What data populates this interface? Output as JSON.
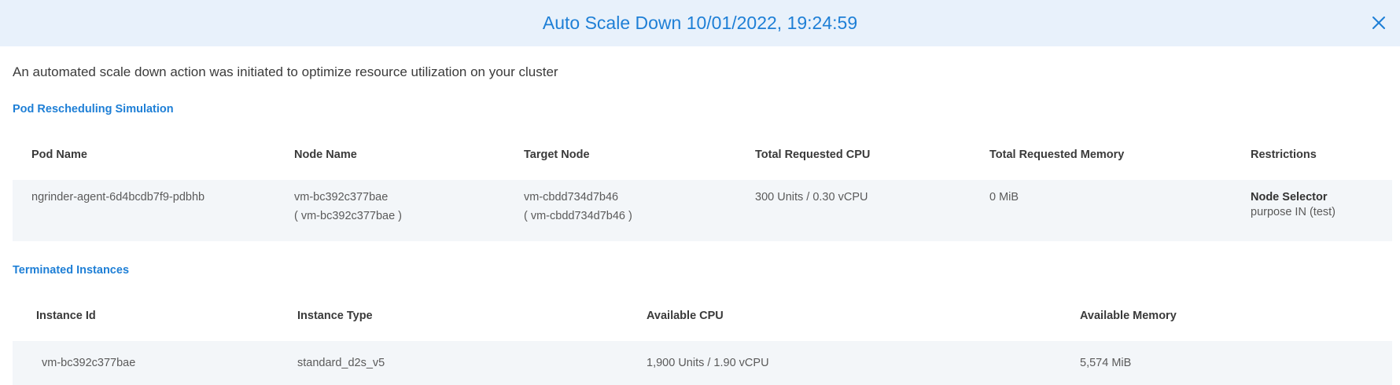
{
  "header": {
    "title": "Auto Scale Down 10/01/2022, 19:24:59",
    "close_icon": "close-icon"
  },
  "description": "An automated scale down action was initiated to optimize resource utilization on your cluster",
  "pod_section": {
    "title": "Pod Rescheduling Simulation",
    "columns": [
      "Pod Name",
      "Node Name",
      "Target Node",
      "Total Requested CPU",
      "Total Requested Memory",
      "Restrictions"
    ],
    "rows": [
      {
        "pod_name": "ngrinder-agent-6d4bcdb7f9-pdbhb",
        "node_name": "vm-bc392c377bae",
        "node_name_sub": "( vm-bc392c377bae )",
        "target_node": "vm-cbdd734d7b46",
        "target_node_sub": "( vm-cbdd734d7b46 )",
        "cpu": "300 Units / 0.30 vCPU",
        "memory": "0 MiB",
        "restriction_label": "Node Selector",
        "restriction_value": "purpose IN (test)"
      }
    ]
  },
  "terminated_section": {
    "title": "Terminated Instances",
    "columns": [
      "Instance Id",
      "Instance Type",
      "Available CPU",
      "Available Memory"
    ],
    "rows": [
      {
        "instance_id": "vm-bc392c377bae",
        "instance_type": "standard_d2s_v5",
        "cpu": "1,900 Units / 1.90 vCPU",
        "memory": "5,574 MiB"
      }
    ]
  },
  "colors": {
    "accent": "#1e7fd6",
    "header_bg": "#e8f1fb",
    "row_bg": "#f3f6f9"
  }
}
